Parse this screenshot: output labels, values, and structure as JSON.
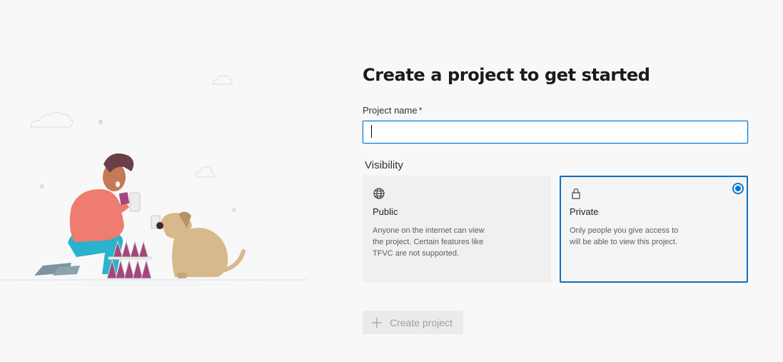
{
  "title": "Create a project to get started",
  "project_name": {
    "label": "Project name",
    "required_marker": "*",
    "value": ""
  },
  "visibility": {
    "label": "Visibility",
    "selected": "private",
    "options": [
      {
        "id": "public",
        "icon": "globe-icon",
        "title": "Public",
        "description": "Anyone on the internet can view the project. Certain features like TFVC are not supported."
      },
      {
        "id": "private",
        "icon": "lock-icon",
        "title": "Private",
        "description": "Only people you give access to will be able to view this project."
      }
    ]
  },
  "create_button": {
    "label": "Create project",
    "icon": "plus-icon",
    "enabled": false
  },
  "colors": {
    "accent": "#0078d4",
    "background": "#f8f8f8",
    "required": "#a4262c"
  }
}
